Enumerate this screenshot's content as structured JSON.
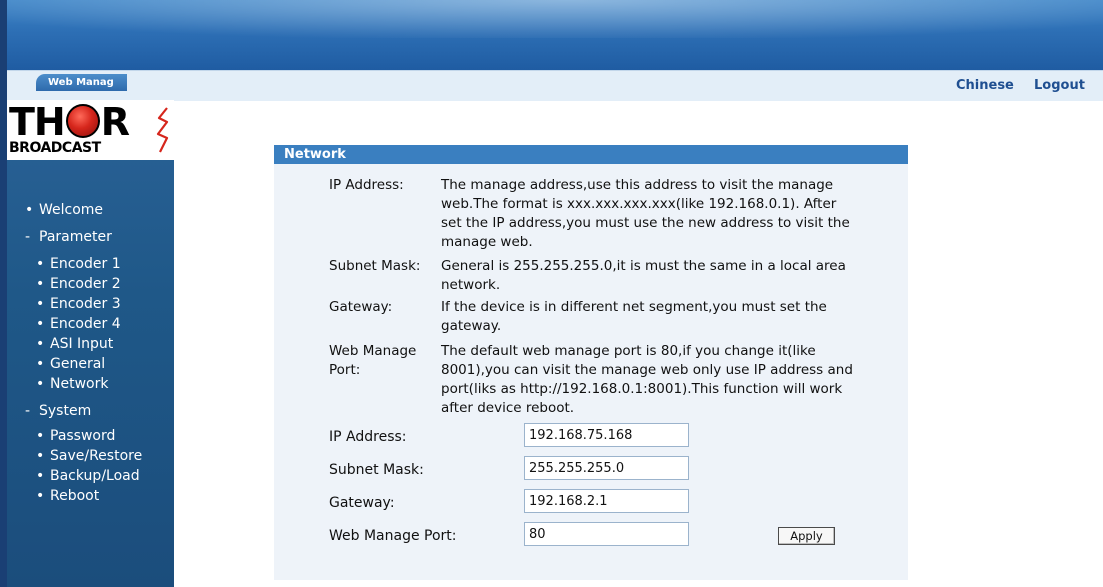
{
  "header": {
    "tab_title": "Web Manag",
    "links": {
      "chinese": "Chinese",
      "logout": "Logout"
    }
  },
  "logo": {
    "word_pre": "TH",
    "word_post": "R",
    "sub": "BROADCAST"
  },
  "sidebar": {
    "welcome": "Welcome",
    "parameter": "Parameter",
    "parameter_items": [
      "Encoder 1",
      "Encoder 2",
      "Encoder 3",
      "Encoder 4",
      "ASI Input",
      "General",
      "Network"
    ],
    "system": "System",
    "system_items": [
      "Password",
      "Save/Restore",
      "Backup/Load",
      "Reboot"
    ]
  },
  "panel": {
    "title": "Network",
    "help": [
      {
        "label": "IP Address:",
        "text": "The manage address,use this address to visit the manage web.The format is xxx.xxx.xxx.xxx(like 192.168.0.1). After set the IP address,you must use the new address to visit the manage web."
      },
      {
        "label": "Subnet Mask:",
        "text": "General is 255.255.255.0,it is must the same in a local area network."
      },
      {
        "label": "Gateway:",
        "text": "If the device is in different net segment,you must set the gateway."
      },
      {
        "label": "Web Manage Port:",
        "text": "The default web manage port is 80,if you change it(like 8001),you can visit the manage web only use IP address and port(liks as http://192.168.0.1:8001).This function will work after device reboot."
      }
    ],
    "form": {
      "ip_label": "IP Address:",
      "ip_value": "192.168.75.168",
      "mask_label": "Subnet Mask:",
      "mask_value": "255.255.255.0",
      "gateway_label": "Gateway:",
      "gateway_value": "192.168.2.1",
      "port_label": "Web Manage Port:",
      "port_value": "80",
      "apply_label": "Apply"
    }
  },
  "colors": {
    "banner": "#2d6fb5",
    "sidebar": "#1f5888",
    "panel_header": "#3a7fc0",
    "panel_bg": "#eef3f9",
    "link": "#1f4f91"
  }
}
